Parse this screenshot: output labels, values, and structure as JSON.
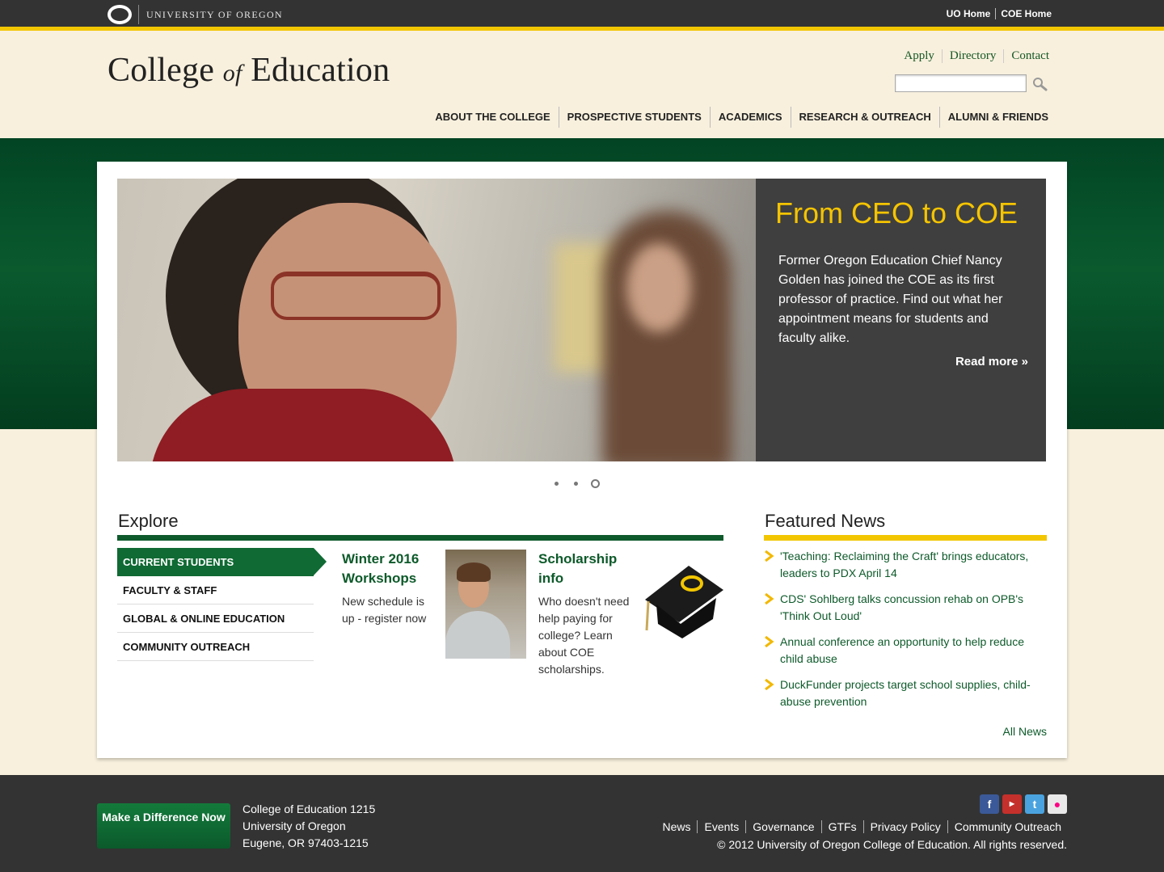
{
  "topbar": {
    "university": "UNIVERSITY OF OREGON",
    "links": [
      "UO Home",
      "COE Home"
    ]
  },
  "header": {
    "title_part1": "College ",
    "title_of": "of",
    "title_part2": " Education",
    "util_links": [
      "Apply",
      "Directory",
      "Contact"
    ],
    "search_value": "",
    "nav": [
      "ABOUT THE COLLEGE",
      "PROSPECTIVE STUDENTS",
      "ACADEMICS",
      "RESEARCH & OUTREACH",
      "ALUMNI & FRIENDS"
    ]
  },
  "hero": {
    "title": "From CEO to COE",
    "text": "Former Oregon Education Chief Nancy Golden has joined the COE as its first professor of practice. Find out what her appointment means for students and faculty alike.",
    "read_more": "Read more »",
    "slides": 3,
    "active_slide": 3
  },
  "explore": {
    "heading": "Explore",
    "items": [
      "CURRENT STUDENTS",
      "FACULTY & STAFF",
      "GLOBAL & ONLINE EDUCATION",
      "COMMUNITY OUTREACH"
    ],
    "active_item": "CURRENT STUDENTS",
    "promos": [
      {
        "title": "Winter 2016 Workshops",
        "text": "New schedule is up - register now"
      },
      {
        "title": "Scholarship info",
        "text": "Who doesn't need help paying for college? Learn about COE scholarships."
      }
    ]
  },
  "news": {
    "heading": "Featured News",
    "items": [
      "'Teaching: Reclaiming the Craft' brings educators, leaders to PDX April 14",
      "CDS' Sohlberg talks concussion rehab on OPB's 'Think Out Loud'",
      "Annual conference an opportunity to help reduce child abuse",
      "DuckFunder projects target school supplies, child-abuse prevention"
    ],
    "all_news": "All News"
  },
  "footer": {
    "donate": "Make a Difference Now",
    "address": [
      "College of Education 1215",
      "University of Oregon",
      "Eugene, OR 97403-1215"
    ],
    "social": [
      "facebook-icon",
      "youtube-icon",
      "twitter-icon",
      "flickr-icon"
    ],
    "links": [
      "News",
      "Events",
      "Governance",
      "GTFs",
      "Privacy Policy",
      "Community Outreach"
    ],
    "copyright": "© 2012 University of Oregon College of Education. All rights reserved."
  },
  "colors": {
    "uo_green": "#0f6a33",
    "uo_yellow": "#f2c600",
    "dark": "#333333",
    "cream": "#f8f0dd"
  }
}
